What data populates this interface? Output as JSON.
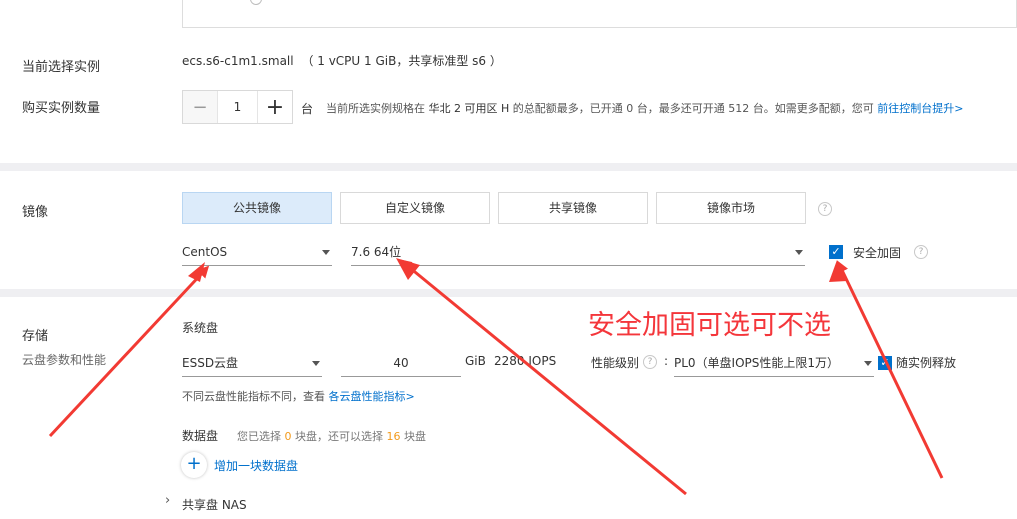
{
  "purchase": {
    "current_instance_label": "当前选择实例",
    "instance_name": "ecs.s6-c1m1.small",
    "instance_spec": "（ 1 vCPU 1 GiB，共享标准型 s6 ）",
    "quantity_label": "购买实例数量",
    "quantity_value": "1",
    "minus_symbol": "−",
    "plus_symbol": "+",
    "unit": "台",
    "quota_text_1": "当前所选实例规格在",
    "quota_region": "华北 2 可用区 H",
    "quota_text_2": "的总配额最多，已开通 0 台，最多还可开通 512 台。如需更多配额，您可",
    "quota_link": "前往控制台提升>"
  },
  "image": {
    "section_label": "镜像",
    "tabs": [
      "公共镜像",
      "自定义镜像",
      "共享镜像",
      "镜像市场"
    ],
    "os_value": "CentOS",
    "version_value": "7.6 64位",
    "security_label": "安全加固",
    "help_glyph": "?"
  },
  "storage": {
    "section_label": "存储",
    "section_sub": "云盘参数和性能",
    "system_disk_label": "系统盘",
    "disk_type": "ESSD云盘",
    "disk_size": "40",
    "disk_unit": "GiB",
    "iops": "2280 IOPS",
    "perf_label": "性能级别",
    "perf_colon": ":",
    "perf_value": "PL0（单盘IOPS性能上限1万）",
    "release_label": "随实例释放",
    "perf_note": "不同云盘性能指标不同，查看",
    "perf_link": "各云盘性能指标>",
    "data_disk_label": "数据盘",
    "data_disk_text_1": "您已选择",
    "data_disk_selected": "0",
    "data_disk_text_2": "块盘，还可以选择",
    "data_disk_remaining": "16",
    "data_disk_text_3": "块盘",
    "add_disk_label": "增加一块数据盘",
    "nas_label": "共享盘 NAS",
    "nas_chevron": "›"
  },
  "annotation": {
    "text": "安全加固可选可不选",
    "color": "#f4363b"
  },
  "colors": {
    "accent": "#0070cc",
    "active_tab": "#dcebfa",
    "highlight_orange": "#f29b1d"
  }
}
